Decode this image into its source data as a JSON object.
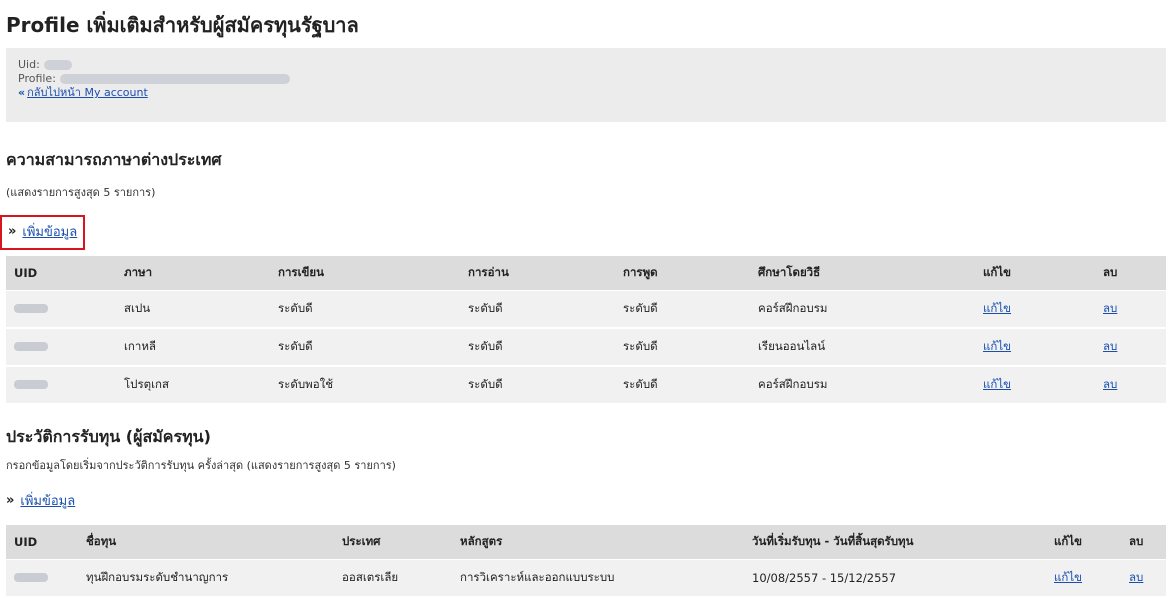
{
  "page_title": "Profile เพิ่มเติมสำหรับผู้สมัครทุนรัฐบาล",
  "profile_info": {
    "uid_label": "Uid:",
    "profile_label": "Profile:",
    "back_link_icon": "«",
    "back_link": "กลับไปหน้า My account"
  },
  "language_section": {
    "title": "ความสามารถภาษาต่างประเทศ",
    "note": "(แสดงรายการสูงสุด 5 รายการ)",
    "add_icon": "»",
    "add_link": "เพิ่มข้อมูล",
    "columns": [
      "UID",
      "ภาษา",
      "การเขียน",
      "การอ่าน",
      "การพูด",
      "ศึกษาโดยวิธี",
      "แก้ไข",
      "ลบ"
    ],
    "rows": [
      {
        "language": "สเปน",
        "writing": "ระดับดี",
        "reading": "ระดับดี",
        "speaking": "ระดับดี",
        "method": "คอร์สฝึกอบรม",
        "edit": "แก้ไข",
        "delete": "ลบ"
      },
      {
        "language": "เกาหลี",
        "writing": "ระดับดี",
        "reading": "ระดับดี",
        "speaking": "ระดับดี",
        "method": "เรียนออนไลน์",
        "edit": "แก้ไข",
        "delete": "ลบ"
      },
      {
        "language": "โปรตุเกส",
        "writing": "ระดับพอใช้",
        "reading": "ระดับดี",
        "speaking": "ระดับดี",
        "method": "คอร์สฝึกอบรม",
        "edit": "แก้ไข",
        "delete": "ลบ"
      }
    ]
  },
  "scholarship_section": {
    "title": "ประวัติการรับทุน (ผู้สมัครทุน)",
    "note": "กรอกข้อมูลโดยเริ่มจากประวัติการรับทุน ครั้งล่าสุด (แสดงรายการสูงสุด 5 รายการ)",
    "add_icon": "»",
    "add_link": "เพิ่มข้อมูล",
    "columns": [
      "UID",
      "ชื่อทุน",
      "ประเทศ",
      "หลักสูตร",
      "วันที่เริ่มรับทุน - วันที่สิ้นสุดรับทุน",
      "แก้ไข",
      "ลบ"
    ],
    "rows": [
      {
        "name": "ทุนฝึกอบรมระดับชำนาญการ",
        "country": "ออสเตรเลีย",
        "course": "การวิเคราะห์และออกแบบระบบ",
        "period": "10/08/2557 - 15/12/2557",
        "edit": "แก้ไข",
        "delete": "ลบ"
      }
    ]
  }
}
